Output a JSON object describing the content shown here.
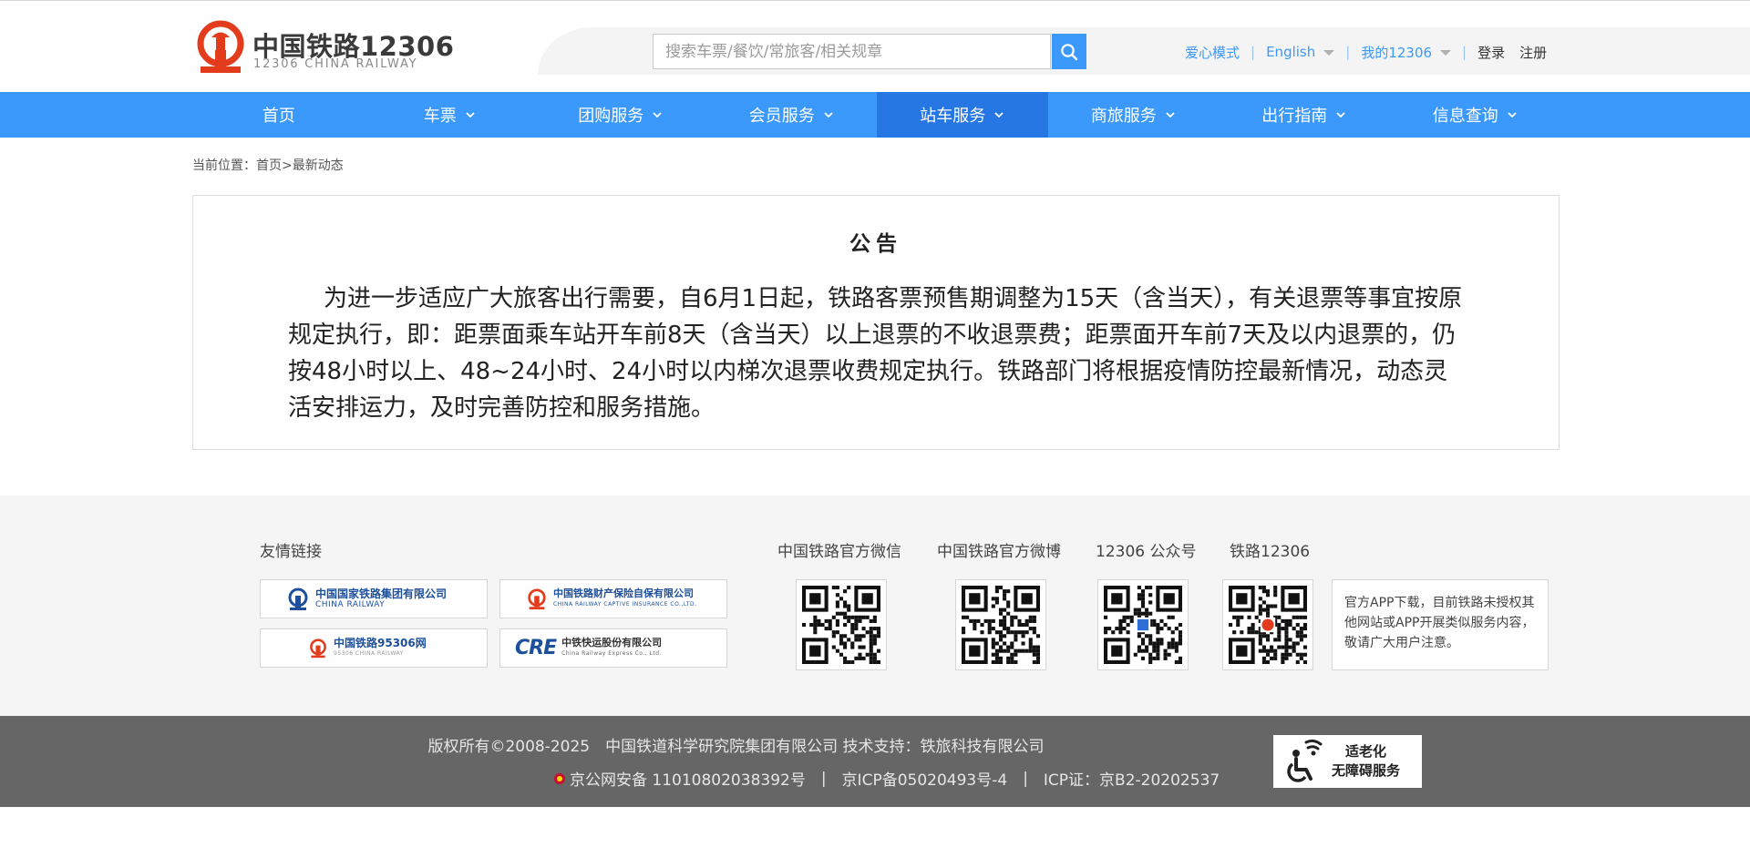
{
  "header": {
    "logo_cn": "中国铁路12306",
    "logo_en": "12306 CHINA RAILWAY",
    "search_placeholder": "搜索车票/餐饮/常旅客/相关规章",
    "links": {
      "care_mode": "爱心模式",
      "english": "English",
      "my12306": "我的12306",
      "login": "登录",
      "register": "注册"
    },
    "accent_color": "#3b99fc",
    "logo_color": "#e33c1d"
  },
  "nav": {
    "items": [
      {
        "label": "首页"
      },
      {
        "label": "车票"
      },
      {
        "label": "团购服务"
      },
      {
        "label": "会员服务"
      },
      {
        "label": "站车服务"
      },
      {
        "label": "商旅服务"
      },
      {
        "label": "出行指南"
      },
      {
        "label": "信息查询"
      }
    ],
    "active": "站车服务"
  },
  "breadcrumb": {
    "prefix": "当前位置：",
    "home": "首页",
    "sep": ">",
    "current": "最新动态"
  },
  "notice": {
    "title": "公告",
    "body": "为进一步适应广大旅客出行需要，自6月1日起，铁路客票预售期调整为15天（含当天），有关退票等事宜按原规定执行，即：距票面乘车站开车前8天（含当天）以上退票的不收退票费；距票面开车前7天及以内退票的，仍按48小时以上、48~24小时、24小时以内梯次退票收费规定执行。铁路部门将根据疫情防控最新情况，动态灵活安排运力，及时完善防控和服务措施。"
  },
  "friends": {
    "title": "友情链接",
    "partners": [
      {
        "name": "中国国家铁路集团有限公司",
        "sub": "CHINA RAILWAY"
      },
      {
        "name": "中国铁路财产保险自保有限公司",
        "sub": "CHINA RAILWAY CAPTIVE INSURANCE CO.,LTD."
      },
      {
        "name": "中国铁路95306网",
        "sub": "95306 CHINA RAILWAY"
      },
      {
        "name": "中铁快运股份有限公司",
        "sub": "China Railway Express Co., Ltd."
      }
    ],
    "partner_logo_text": "CRE",
    "qr_labels": [
      "中国铁路官方微信",
      "中国铁路官方微博",
      "12306 公众号",
      "铁路12306"
    ],
    "app_note": "官方APP下载，目前铁路未授权其他网站或APP开展类似服务内容，敬请广大用户注意。"
  },
  "footer": {
    "copyright": "版权所有©2008-2025　中国铁道科学研究院集团有限公司 技术支持：铁旅科技有限公司",
    "police": "京公网安备 11010802038392号",
    "icp": "京ICP备05020493号-4",
    "icp_cert": "ICP证：京B2-20202537",
    "separator": "|",
    "badge_line1": "适老化",
    "badge_line2": "无障碍服务"
  }
}
